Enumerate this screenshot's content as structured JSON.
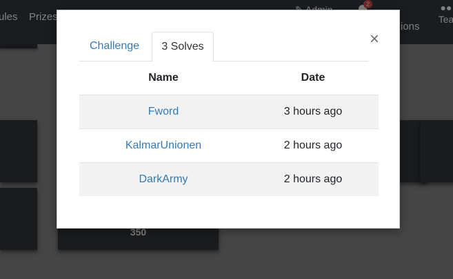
{
  "background": {
    "nav": {
      "rules": "ules",
      "prizes": "Prizes",
      "admin": "Admin",
      "notification_count": "2",
      "options": "ions",
      "teams": "Tea"
    },
    "tile_value": "350"
  },
  "modal": {
    "tabs": [
      {
        "label": "Challenge",
        "active": false
      },
      {
        "label": "3 Solves",
        "active": true
      }
    ],
    "close_label": "×",
    "table": {
      "headers": [
        "Name",
        "Date"
      ],
      "rows": [
        {
          "name": "Fword",
          "date": "3 hours ago"
        },
        {
          "name": "KalmarUnionen",
          "date": "2 hours ago"
        },
        {
          "name": "DarkArmy",
          "date": "2 hours ago"
        }
      ]
    }
  },
  "colors": {
    "link": "#337ab7",
    "navbar": "#343a40",
    "stripe": "#f2f2f2",
    "badge": "#d9534f"
  },
  "icons": {
    "admin": "wrench-icon",
    "notifications": "bell-icon",
    "teams": "people-icon",
    "close": "close-icon"
  }
}
